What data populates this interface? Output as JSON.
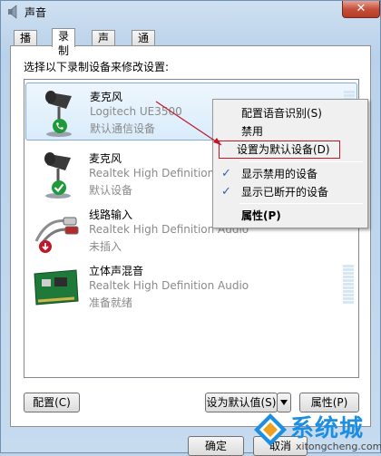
{
  "window": {
    "title": "声音",
    "close_label": "✕"
  },
  "tabs": [
    {
      "label": "播放"
    },
    {
      "label": "录制"
    },
    {
      "label": "声音"
    },
    {
      "label": "通信"
    }
  ],
  "instruction": "选择以下录制设备来修改设置:",
  "devices": [
    {
      "name": "麦克风",
      "driver": "Logitech UE3500",
      "status": "默认通信设备",
      "icon": "microphone-icon",
      "badge": "phone-badge-icon"
    },
    {
      "name": "麦克风",
      "driver": "Realtek High Definition Audio",
      "status": "默认设备",
      "icon": "microphone-icon",
      "badge": "green-check-badge-icon"
    },
    {
      "name": "线路输入",
      "driver": "Realtek High Definition Audio",
      "status": "未插入",
      "icon": "line-in-cable-icon",
      "badge": "red-down-arrow-badge-icon"
    },
    {
      "name": "立体声混音",
      "driver": "Realtek High Definition Audio",
      "status": "准备就绪",
      "icon": "sound-card-icon",
      "badge": ""
    }
  ],
  "context_menu": {
    "items": [
      {
        "label": "配置语音识别(S)",
        "checked": false
      },
      {
        "label": "禁用",
        "checked": false
      },
      {
        "label": "设置为默认设备(D)",
        "checked": false,
        "highlighted": true
      },
      {
        "label": "显示禁用的设备",
        "checked": true
      },
      {
        "label": "显示已断开的设备",
        "checked": true
      },
      {
        "label": "属性(P)",
        "checked": false,
        "bold": true
      }
    ]
  },
  "buttons": {
    "configure": "配置(C)",
    "set_default": "设为默认值(S)",
    "properties": "属性(P)",
    "ok": "确定",
    "cancel": "取消"
  },
  "watermark": {
    "text": "系统城",
    "url": "xitongcheng.com"
  },
  "colors": {
    "accent": "#2a62b8",
    "annotation_red": "#c0182a",
    "watermark_blue": "#1d8ee0"
  }
}
